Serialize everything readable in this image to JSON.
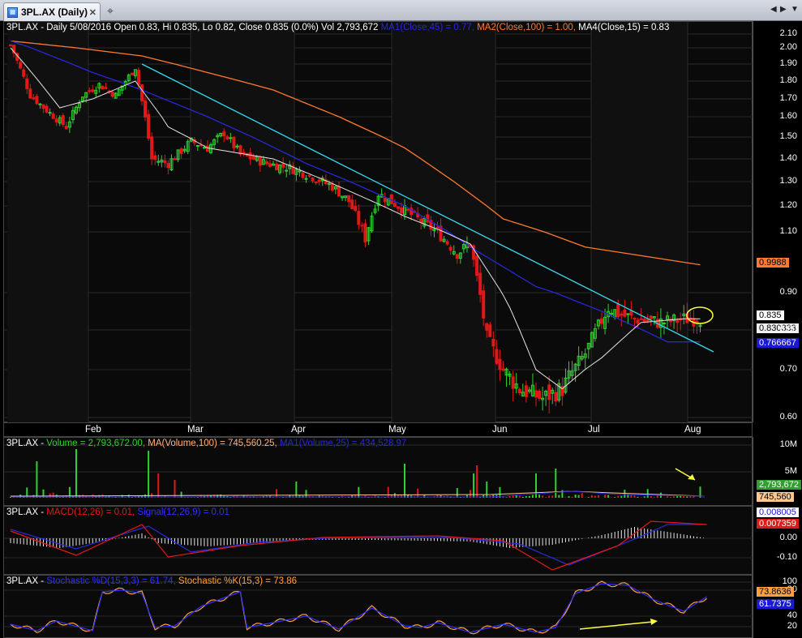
{
  "tab": {
    "title": "3PL.AX (Daily)",
    "icon": "chart-tab-icon"
  },
  "price_pane": {
    "title_prefix": "3PL.AX - Daily 5/08/2016 Open 0.83, Hi 0.835, Lo 0.82, Close 0.835 (0.0%) Vol 2,793,672",
    "ma1": "MA1(Close,45) = 0.77,",
    "ma2": "MA2(Close,100) = 1.00,",
    "ma4": "MA4(Close,15) = 0.83",
    "ticks": [
      "2.10",
      "2.00",
      "1.90",
      "1.80",
      "1.70",
      "1.60",
      "1.50",
      "1.40",
      "1.30",
      "1.20",
      "1.10",
      "0.90",
      "0.80",
      "0.70",
      "0.60"
    ],
    "tags": {
      "ma2": "0.9988",
      "close": "0.835",
      "ma4": "0.830333",
      "ma1": "0.766667"
    }
  },
  "x_labels": [
    "Feb",
    "Mar",
    "Apr",
    "May",
    "Jun",
    "Jul",
    "Aug"
  ],
  "volume_pane": {
    "prefix": "3PL.AX - ",
    "volume": "Volume = 2,793,672.00,",
    "ma100": "MA(Volume,100) = 745,560.25,",
    "ma25": "MA1(Volume,25) = 434,528.97",
    "ticks": [
      "10M",
      "5M"
    ],
    "tags": {
      "vol": "2,793,672",
      "ma": "745,560"
    }
  },
  "macd_pane": {
    "prefix": "3PL.AX - ",
    "macd": "MACD(12,26) = 0.01,",
    "signal": "Signal(12,26,9) = 0.01",
    "ticks": [
      "0.00",
      "-0.10"
    ],
    "tags": {
      "signal": "0.008005",
      "macd": "0.007359"
    }
  },
  "stoch_pane": {
    "prefix": "3PL.AX - ",
    "d": "Stochastic %D(15,3,3) = 61.74,",
    "k": "Stochastic %K(15,3) = 73.86",
    "ticks": [
      "100",
      "80",
      "40",
      "20"
    ],
    "tags": {
      "k": "73.8636",
      "d": "61.7375"
    }
  },
  "colors": {
    "up": "#2fd12f",
    "down": "#e01818",
    "ma1": "#2828d8",
    "ma2": "#ff7a30",
    "ma4": "#e6e6e6",
    "trend": "#38d8f0",
    "macd": "#e01818",
    "signal": "#2a2ae0",
    "stoch_d": "#3030ff",
    "stoch_k": "#ffa040",
    "arrow": "#ffff40"
  }
}
